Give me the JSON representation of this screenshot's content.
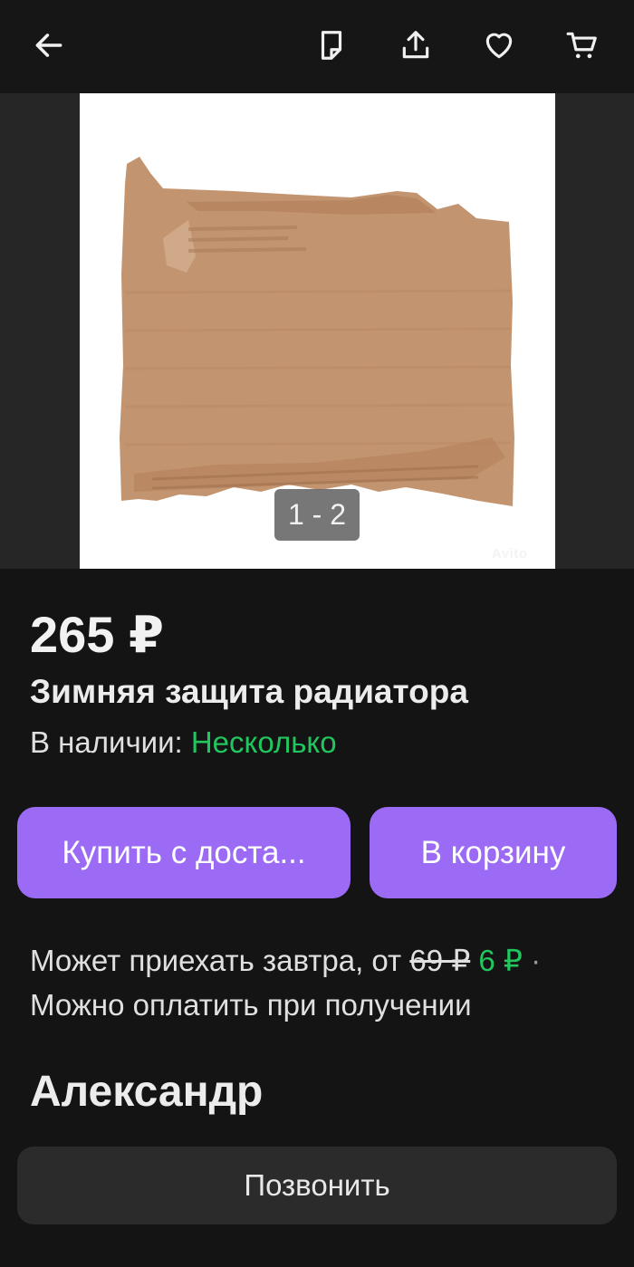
{
  "toolbar": {
    "back_icon": "arrow-left-icon",
    "note_icon": "note-icon",
    "share_icon": "share-icon",
    "favorite_icon": "heart-icon",
    "cart_icon": "cart-icon"
  },
  "gallery": {
    "counter": "1 - 2",
    "watermark": "Avito"
  },
  "listing": {
    "price": "265 ₽",
    "title": "Зимняя защита радиатора",
    "availability_label": "В наличии: ",
    "availability_value": "Несколько"
  },
  "actions": {
    "buy_with_delivery": "Купить с доста...",
    "add_to_cart": "В корзину"
  },
  "delivery": {
    "text": "Может приехать завтра, от ",
    "old_price": "69 ₽",
    "new_price": "6 ₽",
    "separator": " · ",
    "payment": "Можно оплатить при получении"
  },
  "seller": {
    "name": "Александр",
    "call_label": "Позвонить"
  },
  "colors": {
    "accent": "#9b6bf5",
    "green": "#22c55e",
    "background": "#141414"
  }
}
